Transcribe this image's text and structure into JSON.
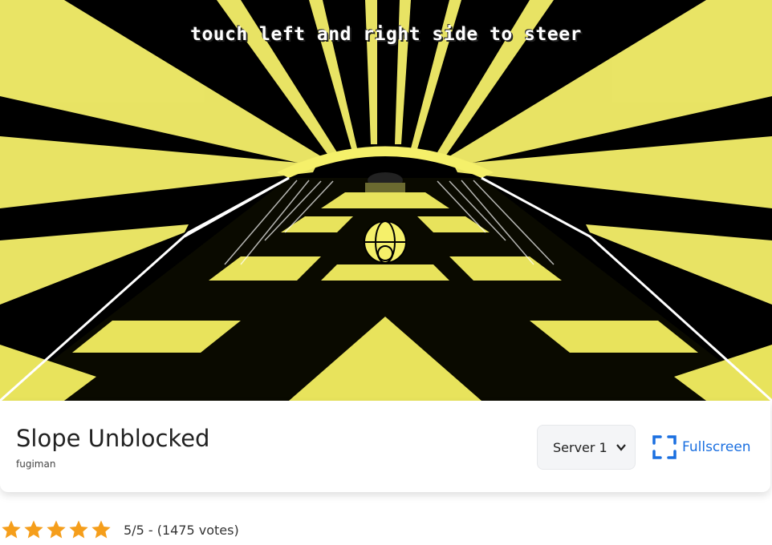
{
  "game": {
    "hint_text": "touch left and right side to steer",
    "colors": {
      "background": "#000000",
      "neon": "#f5f06a",
      "edge": "#ffffff"
    }
  },
  "panel": {
    "title": "Slope Unblocked",
    "author": "fugiman",
    "server_select": {
      "selected": "Server 1"
    },
    "fullscreen_label": "Fullscreen",
    "accent_color": "#1a6fe0"
  },
  "rating": {
    "stars_filled": 5,
    "stars_total": 5,
    "star_color": "#f59e1b",
    "text": "5/5 - (1475 votes)"
  }
}
